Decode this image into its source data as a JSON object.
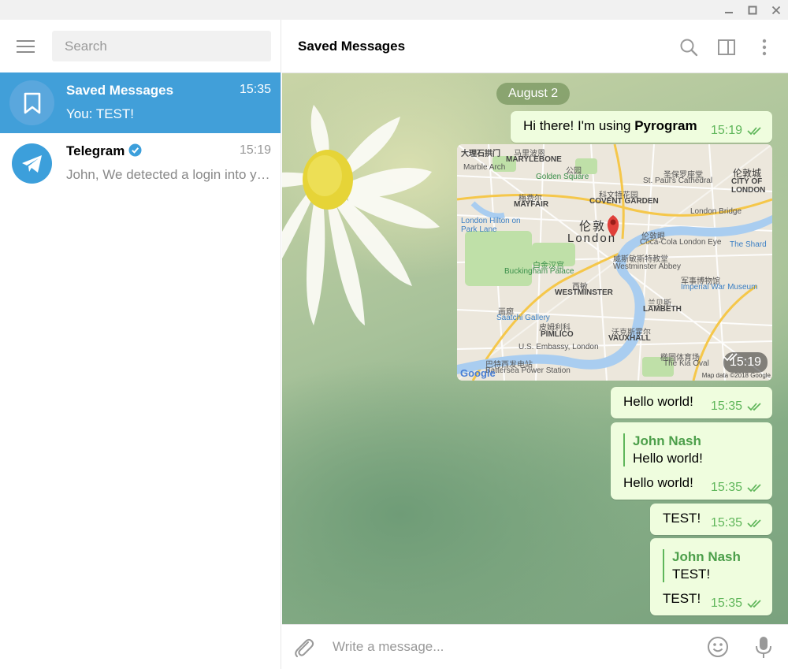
{
  "window": {
    "minimize_icon": "minimize-icon",
    "maximize_icon": "maximize-icon",
    "close_icon": "close-icon"
  },
  "sidebar": {
    "search_placeholder": "Search",
    "chats": [
      {
        "name": "Saved Messages",
        "time": "15:35",
        "preview": "You: TEST!",
        "active": true,
        "icon": "bookmark-icon",
        "avatar_color": "#5aa7dd"
      },
      {
        "name": "Telegram",
        "time": "15:19",
        "preview": "John,  We detected a login into your account",
        "active": false,
        "verified": true,
        "icon": "telegram-icon",
        "avatar_color": "#3c9fdb"
      }
    ]
  },
  "header": {
    "title": "Saved Messages",
    "search_icon": "search-icon",
    "sidebar_toggle_icon": "sidebar-toggle-icon",
    "more_icon": "more-vertical-icon"
  },
  "history": {
    "date": "August 2",
    "messages": [
      {
        "id": "m1",
        "text_prefix": "Hi there! I'm using ",
        "text_bold": "Pyrogram",
        "time": "15:19"
      },
      {
        "id": "m2",
        "type": "location",
        "time": "15:19",
        "map_labels": {
          "marble_arch_cn": "大理石拱门",
          "marble_arch": "Marble Arch",
          "marylebone_cn": "马里波恩",
          "marylebone": "MARYLEBONE",
          "golden_square_cn": "公园",
          "golden_square": "Golden Square",
          "st_pauls_cn": "圣保罗座堂",
          "st_pauls": "St. Paul's Cathedral",
          "city_cn": "伦敦城",
          "city": "CITY OF LONDON",
          "mayfair_cn": "梅费尔",
          "mayfair": "MAYFAIR",
          "covent_cn": "科文特花园",
          "covent": "COVENT GARDEN",
          "hilton": "London Hilton on Park Lane",
          "london_cn": "伦敦",
          "london": "London",
          "london_bridge": "London Bridge",
          "eye_cn": "伦敦眼",
          "eye": "Coca-Cola London Eye",
          "shard": "The Shard",
          "abbey_cn": "威斯敏斯特教堂",
          "abbey": "Westminster Abbey",
          "palace_cn": "白金汉宫",
          "palace": "Buckingham Palace",
          "iwm_cn": "军事博物馆",
          "iwm": "Imperial War Museum",
          "westminster_cn": "西敏",
          "westminster": "WESTMINSTER",
          "lambeth_cn": "兰贝斯",
          "lambeth": "LAMBETH",
          "saatchi_cn": "画廊",
          "saatchi": "Saatchi Gallery",
          "pimlico_cn": "皮姆利科",
          "pimlico": "PIMLICO",
          "vauxhall_cn": "沃克斯霍尔",
          "vauxhall": "VAUXHALL",
          "embassy": "U.S. Embassy, London",
          "oval_cn": "椭圆体育场",
          "oval": "The Kia Oval",
          "battersea_cn": "巴特西发电站",
          "battersea": "Battersea Power Station",
          "google": "Google",
          "map_data": "Map data ©2018 Google"
        }
      },
      {
        "id": "m3",
        "text": "Hello world!",
        "time": "15:35"
      },
      {
        "id": "m4",
        "reply_name": "John Nash",
        "reply_text": "Hello world!",
        "text": "Hello world!",
        "time": "15:35"
      },
      {
        "id": "m5",
        "text": "TEST!",
        "time": "15:35"
      },
      {
        "id": "m6",
        "reply_name": "John Nash",
        "reply_text": "TEST!",
        "text": "TEST!",
        "time": "15:35"
      }
    ]
  },
  "compose": {
    "placeholder": "Write a message...",
    "attach_icon": "paperclip-icon",
    "emoji_icon": "emoji-icon",
    "mic_icon": "microphone-icon"
  },
  "colors": {
    "accent": "#419fd9",
    "bubble_out": "#effdde",
    "read_check": "#5fb65a"
  }
}
